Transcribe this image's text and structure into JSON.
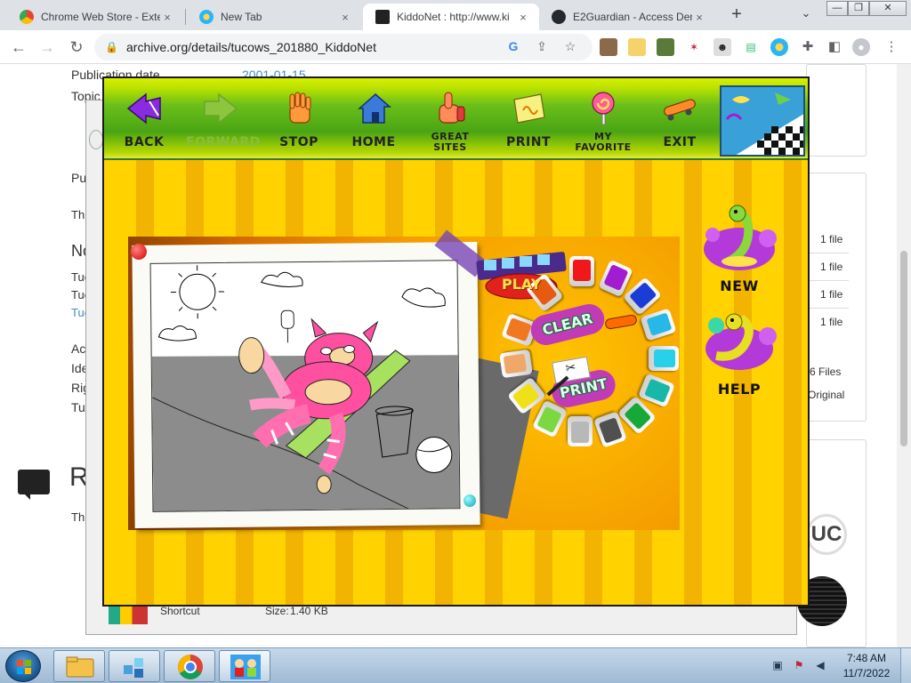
{
  "browser": {
    "tabs": [
      {
        "title": "Chrome Web Store - Exte",
        "close": "×"
      },
      {
        "title": "New Tab",
        "close": "×"
      },
      {
        "title": "KiddoNet : http://www.ki",
        "close": "×"
      },
      {
        "title": "E2Guardian - Access Den",
        "close": "×"
      }
    ],
    "newtab_label": "+",
    "tablist_label": "⌄",
    "window_buttons": {
      "minimize": "—",
      "restore": "❐",
      "close": "✕"
    },
    "url": "archive.org/details/tucows_201880_KiddoNet",
    "back_label": "←",
    "forward_label": "→",
    "reload_label": "↻"
  },
  "archive_page": {
    "publication_date_label": "Publication date",
    "publication_date_value": "2001-01-15",
    "topics_label": "Topic",
    "partial_lines": [
      "Pu",
      "Th",
      "No",
      "Tuc",
      "Tuc",
      "Tuc",
      "Ac",
      "Ide",
      "Rig",
      "Tuc"
    ],
    "reviews_heading": "R",
    "reviews_sub": "Th",
    "file_counts": [
      "1 file",
      "1 file",
      "1 file",
      "1 file"
    ],
    "files_total": "6 Files",
    "original_label": "Original",
    "shortcut_name": "Shortcut",
    "shortcut_size_label": "Size:",
    "shortcut_size_value": "1.40 KB"
  },
  "kiddonet": {
    "nav": [
      {
        "label": "BACK",
        "icon": "back-arrow-icon",
        "enabled": true
      },
      {
        "label": "FORWARD",
        "icon": "forward-arrow-icon",
        "enabled": false
      },
      {
        "label": "STOP",
        "icon": "stop-hand-icon",
        "enabled": true
      },
      {
        "label": "HOME",
        "icon": "home-icon",
        "enabled": true
      },
      {
        "label_line1": "GREAT",
        "label_line2": "SITES",
        "icon": "thumbs-up-icon",
        "enabled": true
      },
      {
        "label": "PRINT",
        "icon": "print-icon",
        "enabled": true
      },
      {
        "label_line1": "MY",
        "label_line2": "FAVORITE",
        "icon": "lollipop-icon",
        "enabled": true
      },
      {
        "label": "EXIT",
        "icon": "skateboard-icon",
        "enabled": true
      }
    ],
    "paint": {
      "clear_label": "CLEAR",
      "print_label": "PRINT",
      "play_label": "PLAY",
      "colors": [
        "#f01818",
        "#a21cd0",
        "#1c3cd8",
        "#28b8e8",
        "#28d0e8",
        "#18b8a8",
        "#18a838",
        "#505050",
        "#b8b8b8",
        "#7cd840",
        "#f0e018",
        "#f0a868",
        "#f07820",
        "#e85a10"
      ]
    },
    "side": {
      "new_label": "NEW",
      "help_label": "HELP"
    }
  },
  "taskbar": {
    "time": "7:48 AM",
    "date": "11/7/2022"
  },
  "colors": {
    "tabstrip": "#dee1e6",
    "app_yellow": "#ffcc00",
    "navbar_green": "#4aa514",
    "taskbar": "#b5cce2"
  }
}
